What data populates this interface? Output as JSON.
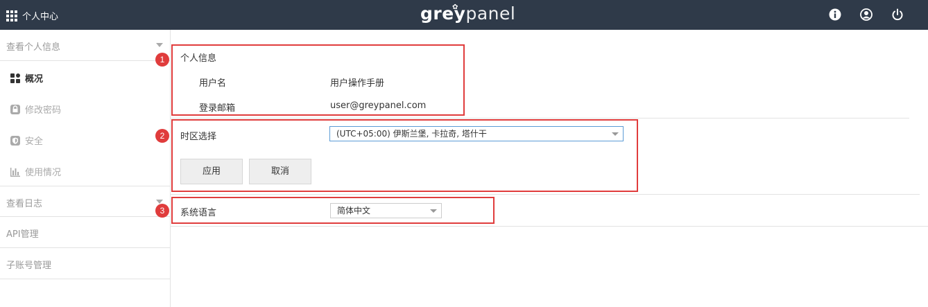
{
  "topbar": {
    "app_menu_label": "个人中心",
    "logo_left": "grey",
    "logo_right": "panel",
    "icons": [
      "info-icon",
      "user-icon",
      "power-icon"
    ]
  },
  "sidebar": {
    "section_profile": "查看个人信息",
    "items": [
      {
        "label": "概况",
        "icon": "dashboard-icon",
        "active": true
      },
      {
        "label": "修改密码",
        "icon": "lock-icon",
        "active": false
      },
      {
        "label": "安全",
        "icon": "shield-icon",
        "active": false
      },
      {
        "label": "使用情况",
        "icon": "bar-chart-icon",
        "active": false
      }
    ],
    "section_logs": "查看日志",
    "section_api": "API管理",
    "section_subaccounts": "子账号管理"
  },
  "profile": {
    "title": "个人信息",
    "username_label": "用户名",
    "username_value": "用户操作手册",
    "email_label": "登录邮箱",
    "email_value": "user@greypanel.com"
  },
  "timezone": {
    "label": "时区选择",
    "selected": "(UTC+05:00) 伊斯兰堡, 卡拉奇, 塔什干",
    "apply_label": "应用",
    "cancel_label": "取消"
  },
  "language": {
    "label": "系统语言",
    "selected": "简体中文"
  },
  "annotations": [
    "1",
    "2",
    "3"
  ],
  "colors": {
    "topbar_bg": "#2f3a49",
    "annotation_red": "#e03c3c",
    "select_focus_border": "#5b9bd5"
  }
}
